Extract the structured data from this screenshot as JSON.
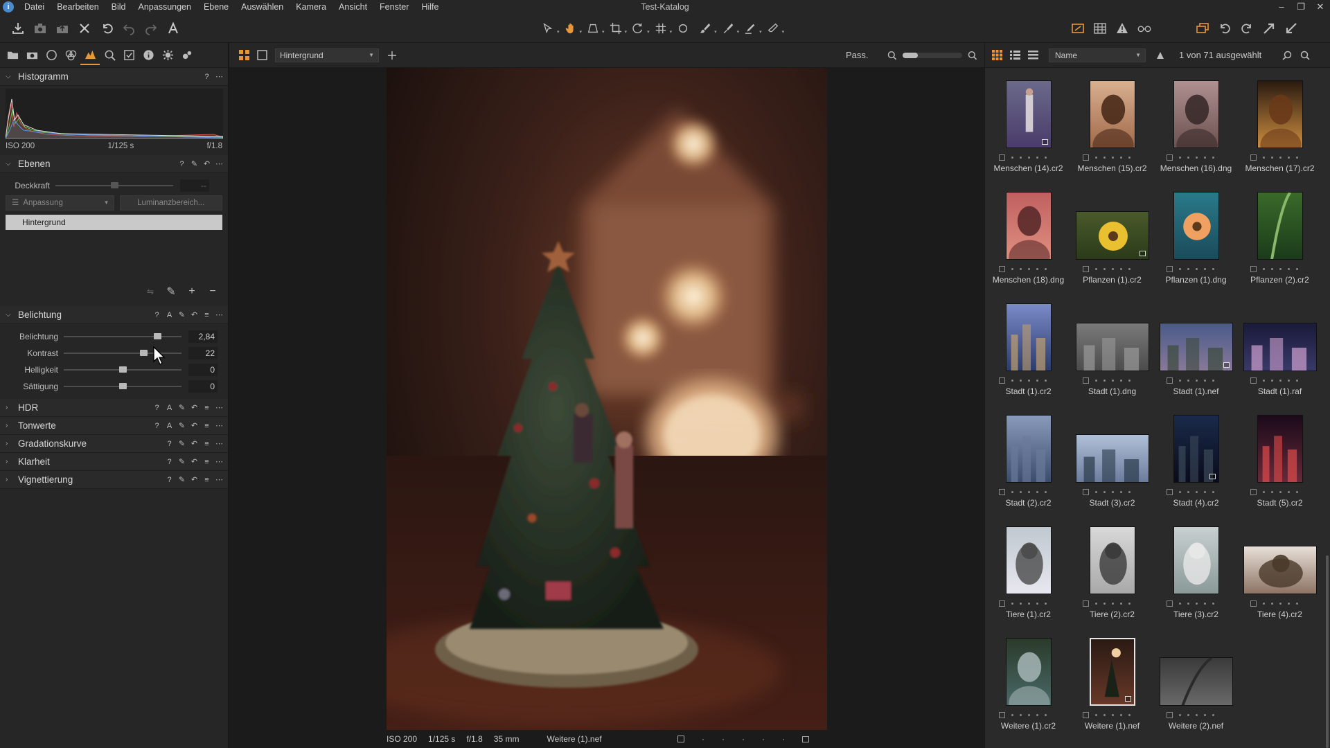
{
  "menubar": {
    "items": [
      "Datei",
      "Bearbeiten",
      "Bild",
      "Anpassungen",
      "Ebene",
      "Auswählen",
      "Kamera",
      "Ansicht",
      "Fenster",
      "Hilfe"
    ],
    "title": "Test-Katalog"
  },
  "panels": {
    "histogram": {
      "title": "Histogramm",
      "iso": "ISO 200",
      "shutter": "1/125 s",
      "aperture": "f/1.8"
    },
    "layers": {
      "title": "Ebenen",
      "opacity_label": "Deckkraft",
      "opacity_value": "--",
      "adjust_label": "Anpassung",
      "luminance_label": "Luminanzbereich...",
      "background_layer": "Hintergrund"
    },
    "exposure": {
      "title": "Belichtung",
      "sliders": [
        {
          "label": "Belichtung",
          "value": "2,84"
        },
        {
          "label": "Kontrast",
          "value": "22"
        },
        {
          "label": "Helligkeit",
          "value": "0"
        },
        {
          "label": "Sättigung",
          "value": "0"
        }
      ]
    },
    "collapsed": [
      "HDR",
      "Tonwerte",
      "Gradationskurve",
      "Klarheit",
      "Vignettierung"
    ]
  },
  "viewer": {
    "layer_select": "Hintergrund",
    "fit_label": "Pass.",
    "status": {
      "iso": "ISO 200",
      "shutter": "1/125 s",
      "aperture": "f/1.8",
      "focal": "35 mm",
      "filename": "Weitere (1).nef"
    }
  },
  "browser": {
    "sort_by": "Name",
    "selection": "1 von 71 ausgewählt",
    "thumbnails": [
      "Menschen (14).cr2",
      "Menschen (15).cr2",
      "Menschen (16).dng",
      "Menschen (17).cr2",
      "Menschen (18).dng",
      "Pflanzen (1).cr2",
      "Pflanzen (1).dng",
      "Pflanzen (2).cr2",
      "Stadt (1).cr2",
      "Stadt (1).dng",
      "Stadt (1).nef",
      "Stadt (1).raf",
      "Stadt (2).cr2",
      "Stadt (3).cr2",
      "Stadt (4).cr2",
      "Stadt (5).cr2",
      "Tiere (1).cr2",
      "Tiere (2).cr2",
      "Tiere (3).cr2",
      "Tiere (4).cr2",
      "Weitere (1).cr2",
      "Weitere (1).nef",
      "Weitere (2).nef"
    ]
  },
  "colors": {
    "accent": "#e8963a",
    "panel": "#262626",
    "selected_layer": "#c9c9c9"
  }
}
